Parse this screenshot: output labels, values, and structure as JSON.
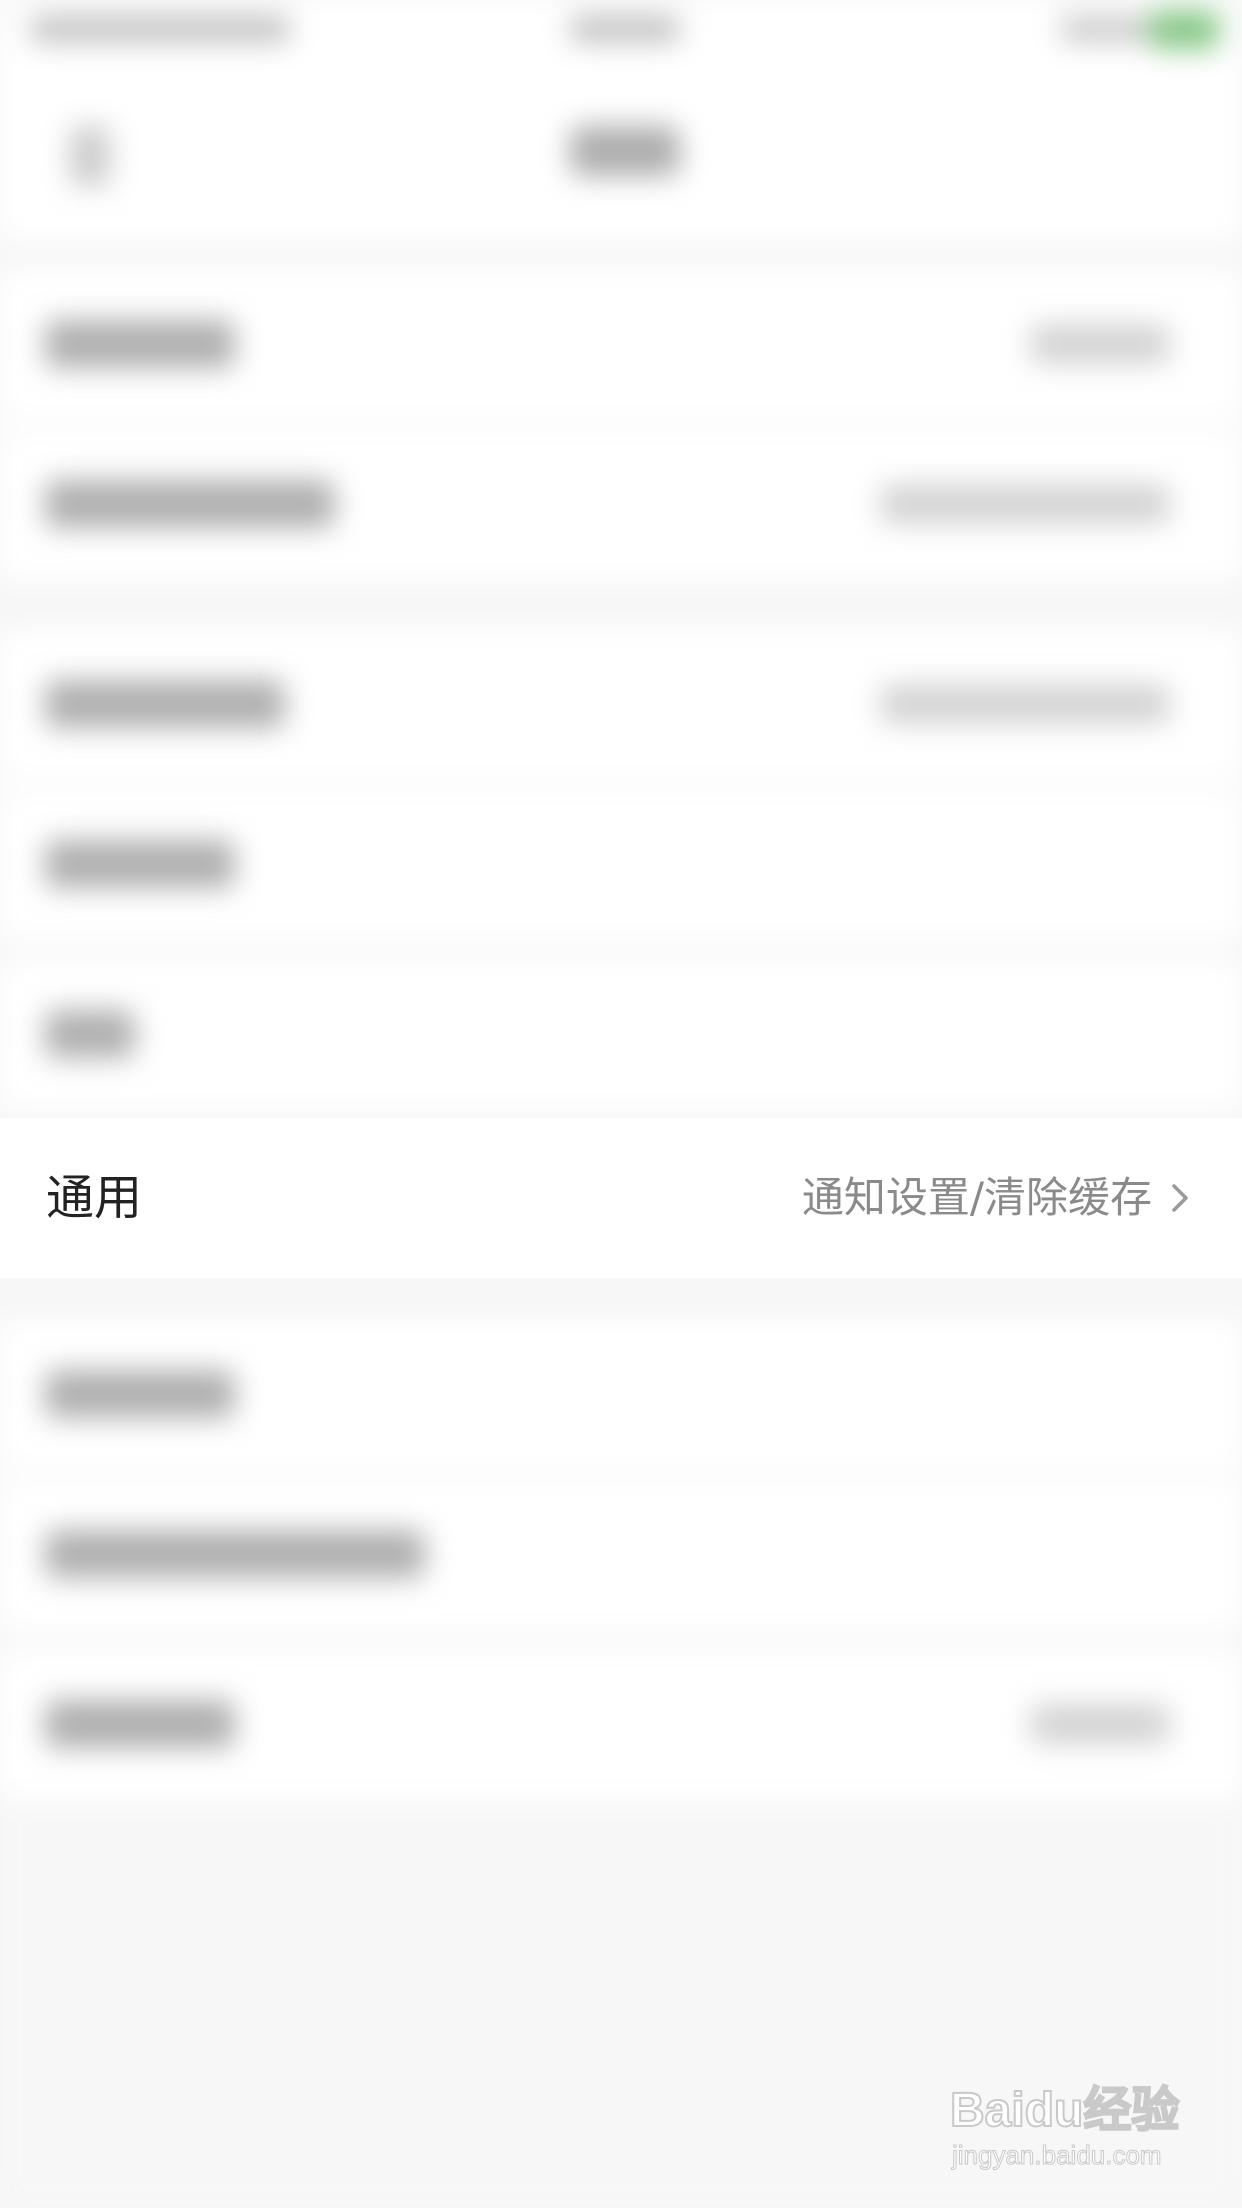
{
  "settings": {
    "general_row": {
      "label": "通用",
      "value": "通知设置/清除缓存"
    }
  },
  "watermark": {
    "logo_text": "Baidu经验",
    "url_text": "jingyan.baidu.com"
  },
  "icons": {
    "chevron": "chevron-right-icon"
  },
  "colors": {
    "background": "#f7f7f7",
    "row_background": "#ffffff",
    "label_text": "#222222",
    "value_text": "#8a8a8a",
    "status_battery": "#66c266"
  }
}
